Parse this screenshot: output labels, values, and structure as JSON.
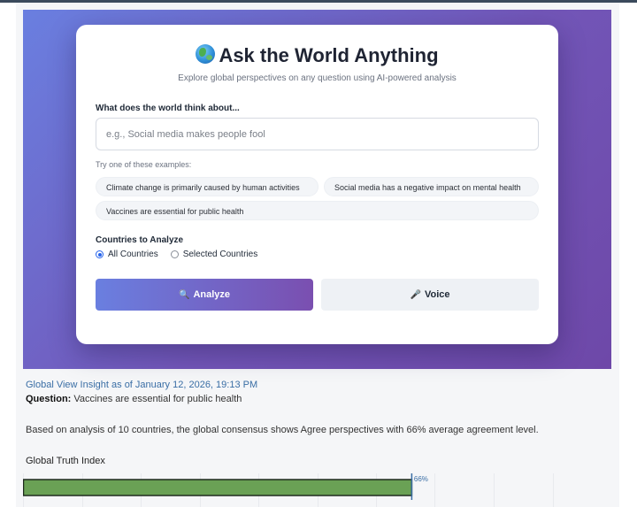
{
  "hero": {
    "title": "Ask the World Anything",
    "globe_icon": "globe-icon",
    "subtitle": "Explore global perspectives on any question using AI-powered analysis"
  },
  "form": {
    "question_label": "What does the world think about...",
    "question_placeholder": "e.g., Social media makes people fool",
    "question_value": "",
    "examples_label": "Try one of these examples:",
    "examples": [
      "Climate change is primarily caused by human activities",
      "Social media has a negative impact on mental health",
      "Vaccines are essential for public health"
    ],
    "countries_label": "Countries to Analyze",
    "country_options": [
      "All Countries",
      "Selected Countries"
    ],
    "selected_option": "All Countries",
    "analyze_label": "Analyze",
    "analyze_icon": "magnifier-icon",
    "voice_label": "Voice",
    "voice_icon": "microphone-icon"
  },
  "result": {
    "insight": "Global View Insight as of January 12, 2026, 19:13 PM",
    "question_prefix": "Question:",
    "question_text": "Vaccines are essential for public health",
    "summary": "Based on analysis of 10 countries, the global consensus shows Agree perspectives with 66% average agreement level.",
    "index_title": "Global Truth Index"
  },
  "colors": {
    "hero_gradient_start": "#6a7fe0",
    "hero_gradient_end": "#6e48a8",
    "bar_fill": "#6aa155",
    "link_blue": "#3a6ea5"
  },
  "chart_data": {
    "type": "bar",
    "orientation": "horizontal",
    "categories": [
      ""
    ],
    "values": [
      66
    ],
    "value_labels": [
      "66%"
    ],
    "xlim": [
      0,
      100
    ],
    "grid": true
  }
}
